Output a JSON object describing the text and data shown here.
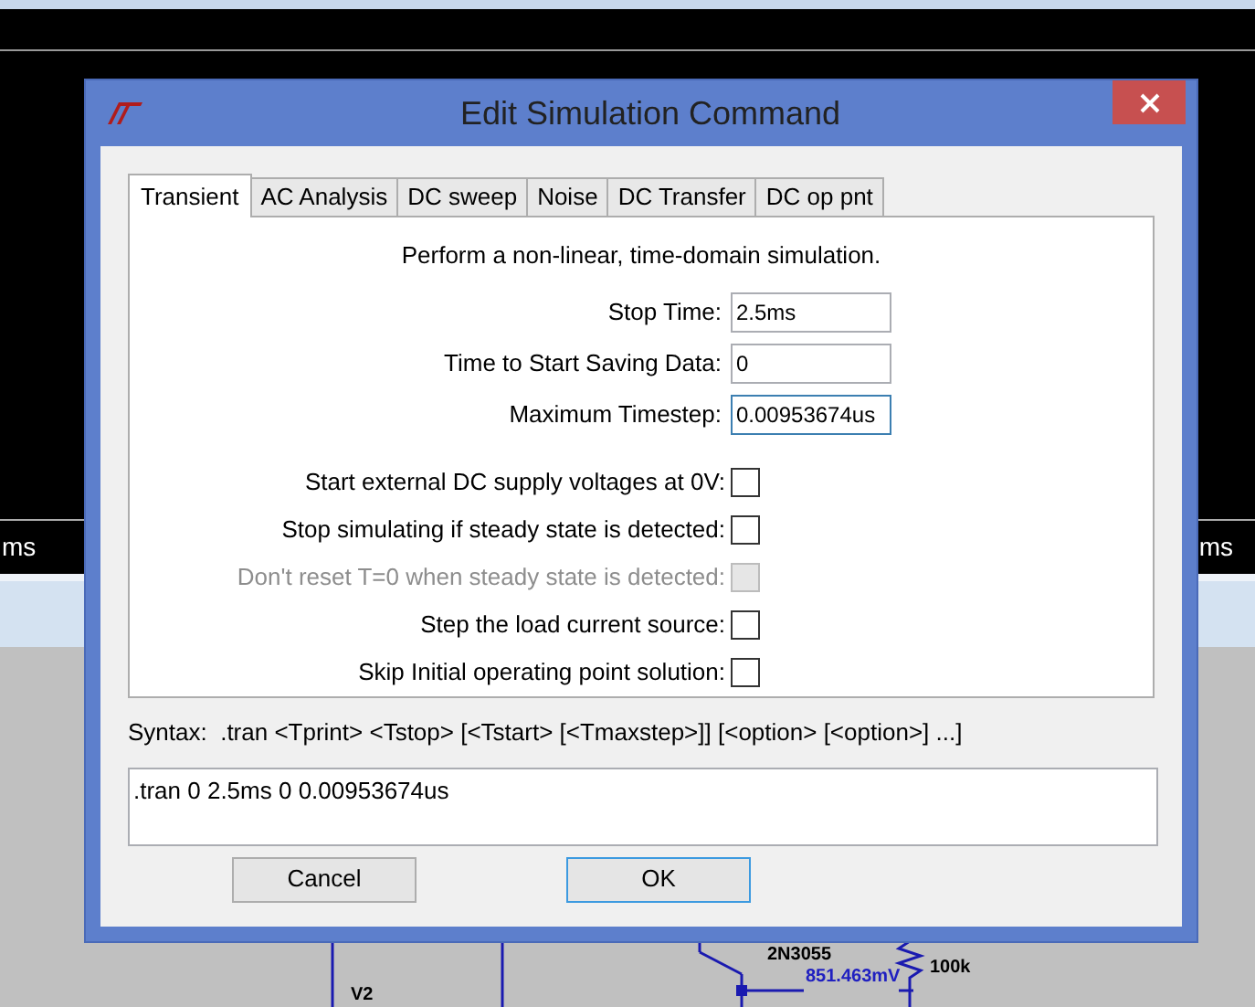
{
  "background": {
    "left_label": "ms",
    "right_label": "ms",
    "schematic_labels": [
      {
        "kind": "part",
        "text": "2N3055"
      },
      {
        "kind": "voltage",
        "text": "851.463mV"
      },
      {
        "kind": "part",
        "text": "100k"
      },
      {
        "kind": "part",
        "text": "V2"
      }
    ]
  },
  "window": {
    "title": "Edit Simulation Command"
  },
  "tabs": [
    {
      "label": "Transient",
      "selected": true
    },
    {
      "label": "AC Analysis",
      "selected": false
    },
    {
      "label": "DC sweep",
      "selected": false
    },
    {
      "label": "Noise",
      "selected": false
    },
    {
      "label": "DC Transfer",
      "selected": false
    },
    {
      "label": "DC op pnt",
      "selected": false
    }
  ],
  "description": "Perform a non-linear, time-domain simulation.",
  "fields": [
    {
      "label": "Stop Time:",
      "value": "2.5ms",
      "focused": false
    },
    {
      "label": "Time to Start Saving Data:",
      "value": "0",
      "focused": false
    },
    {
      "label": "Maximum Timestep:",
      "value": "0.00953674us",
      "focused": true
    }
  ],
  "options": [
    {
      "label": "Start external DC supply voltages at 0V:",
      "checked": false,
      "disabled": false
    },
    {
      "label": "Stop simulating if steady state is detected:",
      "checked": false,
      "disabled": false
    },
    {
      "label": "Don't reset T=0 when steady state is detected:",
      "checked": false,
      "disabled": true
    },
    {
      "label": "Step the load current source:",
      "checked": false,
      "disabled": false
    },
    {
      "label": "Skip Initial operating point solution:",
      "checked": false,
      "disabled": false
    }
  ],
  "syntax": "Syntax:  .tran <Tprint> <Tstop> [<Tstart> [<Tmaxstep>]] [<option> [<option>] ...]",
  "command": ".tran 0 2.5ms 0 0.00953674us",
  "buttons": [
    {
      "label": "Cancel",
      "default": false
    },
    {
      "label": "OK",
      "default": true
    }
  ]
}
